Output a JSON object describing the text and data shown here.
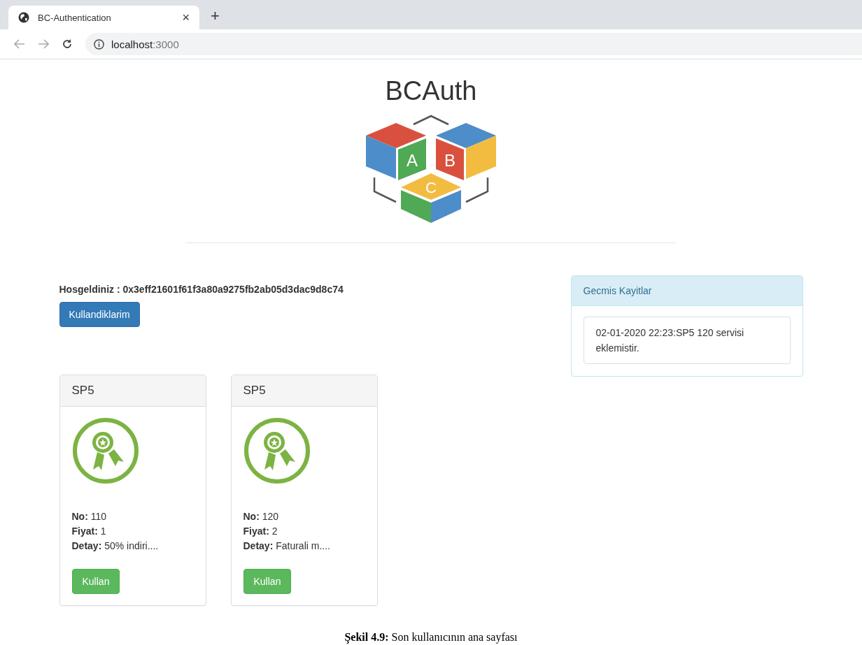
{
  "browser": {
    "tab_title": "BC-Authentication",
    "tab_close": "×",
    "new_tab": "+",
    "url_host": "localhost",
    "url_port": ":3000"
  },
  "header": {
    "title": "BCAuth",
    "logo_letters": [
      "A",
      "B",
      "C"
    ]
  },
  "welcome": {
    "label": "Hosgeldiniz :",
    "address": "0x3eff21601f61f3a80a9275fb2ab05d3dac9d8c74"
  },
  "used_button": "Kullandiklarim",
  "cards": [
    {
      "title": "SP5",
      "fields": [
        {
          "label": "No:",
          "value": "110"
        },
        {
          "label": "Fiyat:",
          "value": "1"
        },
        {
          "label": "Detay:",
          "value": "50% indiri...."
        }
      ],
      "button": "Kullan"
    },
    {
      "title": "SP5",
      "fields": [
        {
          "label": "No:",
          "value": "120"
        },
        {
          "label": "Fiyat:",
          "value": "2"
        },
        {
          "label": "Detay:",
          "value": "Faturali m...."
        }
      ],
      "button": "Kullan"
    }
  ],
  "history": {
    "title": "Gecmis Kayitlar",
    "entries": [
      "02-01-2020 22:23:SP5 120 servisi eklemistir."
    ]
  },
  "caption": {
    "label": "Şekil 4.9:",
    "text": "Son kullanıcının ana sayfası"
  }
}
